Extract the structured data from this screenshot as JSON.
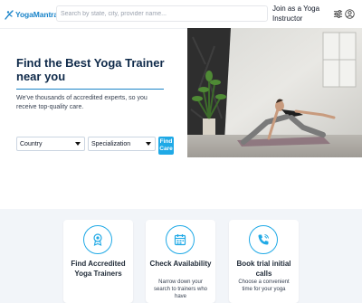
{
  "header": {
    "logo_text": "YogaMantra",
    "search_placeholder": "Search by state, city, provider name...",
    "join_link": "Join as a Yoga Instructor",
    "filter_icon": "sliders-icon",
    "user_icon": "user-circle-icon"
  },
  "hero": {
    "title": "Find the Best Yoga Trainer near you",
    "subtitle": "We've thousands of accredited experts, so you receive top-quality care.",
    "country_select": "Country",
    "specialization_select": "Specialization",
    "find_button": "Find Care",
    "image": "yoga-woman-stretching-photo"
  },
  "features": [
    {
      "icon": "badge-icon",
      "title": "Find Accredited Yoga Trainers",
      "description": ""
    },
    {
      "icon": "calendar-icon",
      "title": "Check Availability",
      "description": "Narrow down your search to trainers who have"
    },
    {
      "icon": "phone-icon",
      "title": "Book trial initial calls",
      "description": "Choose a convenient time for your yoga"
    }
  ],
  "colors": {
    "brand": "#1a84c9",
    "accent": "#1fa9e6",
    "title": "#0f2a4a",
    "section_bg": "#f2f5f9"
  }
}
